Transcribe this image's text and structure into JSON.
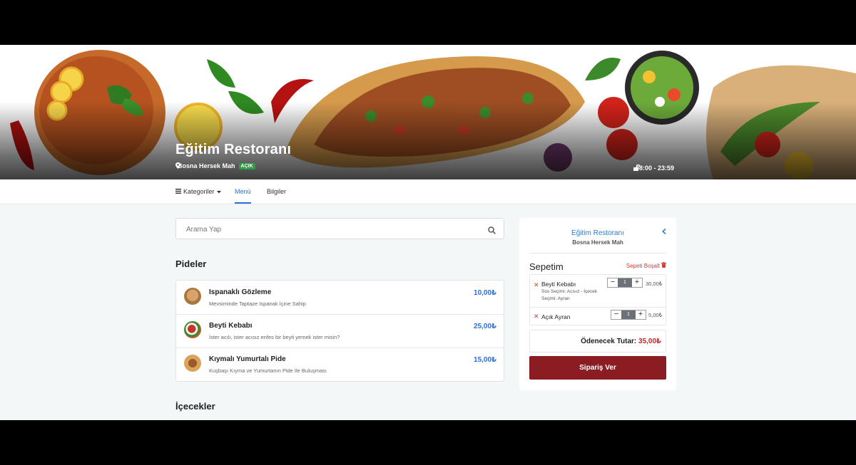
{
  "hero": {
    "title": "Eğitim Restoranı",
    "location": "Bosna Hersek Mah",
    "status_badge": "AÇIK",
    "hours": "08:00 - 23:59"
  },
  "nav": {
    "categories": "Kategoriler",
    "menu": "Menü",
    "info": "Bilgiler"
  },
  "search": {
    "placeholder": "Arama Yap"
  },
  "sections": {
    "pides": "Pideler",
    "drinks": "İçecekler"
  },
  "products": [
    {
      "name": "Ispanaklı Gözleme",
      "desc": "Mevsiminde Taptaze Ispanak İçine Sahip",
      "price": "10,00₺"
    },
    {
      "name": "Beyti Kebabı",
      "desc": "İster acılı, ister acısız enfes bir beyti yemek ister misin?",
      "price": "25,00₺"
    },
    {
      "name": "Kıymalı Yumurtalı Pide",
      "desc": "Kuşbaşı Kıyma ve Yumurtanın Pide İle Buluşması",
      "price": "15,00₺"
    }
  ],
  "cart": {
    "restaurant": "Eğitim Restoranı",
    "address": "Bosna Hersek Mah",
    "title": "Sepetim",
    "clear": "Sepeti Boşalt",
    "items": [
      {
        "name": "Beyti Kebabı",
        "options": "Sos Seçimi: Acısız - İçecek Seçimi: Ayran",
        "qty": "1",
        "price": "30,00₺"
      },
      {
        "name": "Açık Ayran",
        "options": "",
        "qty": "1",
        "price": "5,00₺"
      }
    ],
    "total_label": "Ödenecek Tutar:",
    "total_amount": "35,00₺",
    "order_button": "Sipariş Ver"
  },
  "colors": {
    "accent": "#2a6fdb",
    "order_button": "#8b1d22",
    "open_badge": "#2e9b45",
    "danger": "#d23f3f"
  }
}
